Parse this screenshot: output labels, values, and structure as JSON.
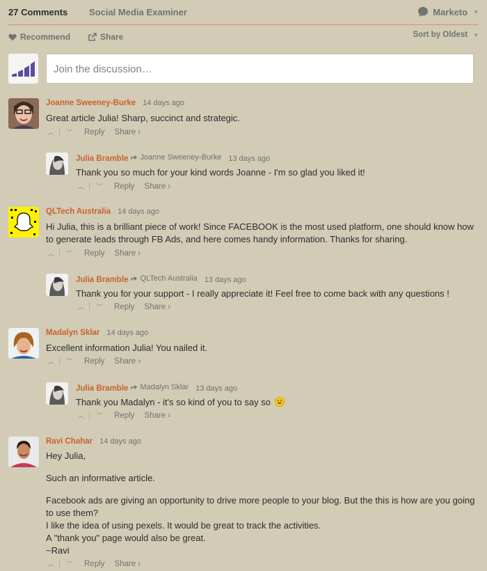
{
  "header": {
    "comments_tab": "27 Comments",
    "site_tab": "Social Media Examiner",
    "user": "Marketo"
  },
  "actions": {
    "recommend": "Recommend",
    "share": "Share",
    "sort": "Sort by Oldest"
  },
  "composer": {
    "placeholder": "Join the discussion…"
  },
  "labels": {
    "reply": "Reply",
    "share": "Share ›"
  },
  "comments": [
    {
      "author": "Joanne Sweeney-Burke",
      "time": "14 days ago",
      "body": [
        "Great article Julia! Sharp, succinct and strategic."
      ],
      "reply": {
        "author": "Julia Bramble",
        "in_reply_to": "Joanne Sweeney-Burke",
        "time": "13 days ago",
        "body": "Thank you so much for your kind words Joanne - I'm so glad you liked it!"
      }
    },
    {
      "author": "QLTech Australia",
      "time": "14 days ago",
      "body": [
        "Hi Julia, this is a brilliant piece of work! Since FACEBOOK is the most used platform, one should know how to generate leads through FB Ads, and here comes handy information. Thanks for sharing."
      ],
      "reply": {
        "author": "Julia Bramble",
        "in_reply_to": "QLTech Australia",
        "time": "13 days ago",
        "body": "Thank you for your support - I really appreciate it! Feel free to come back with any questions !"
      }
    },
    {
      "author": "Madalyn Sklar",
      "time": "14 days ago",
      "body": [
        "Excellent information Julia! You nailed it."
      ],
      "reply": {
        "author": "Julia Bramble",
        "in_reply_to": "Madalyn Sklar",
        "time": "13 days ago",
        "body": "Thank you Madalyn - it's so kind of you to say so"
      }
    },
    {
      "author": "Ravi Chahar",
      "time": "14 days ago",
      "body": [
        "Hey Julia,",
        "Such an informative article.",
        "Facebook ads are giving an opportunity to drive more people to your blog. But the this is how are you going to use them?",
        "I like the idea of using pexels. It would be great to track the activities.",
        "A \"thank you\" page would also be great.",
        "~Ravi"
      ]
    }
  ],
  "colors": {
    "background": "#d2cbb6",
    "author": "#c9622e",
    "accent": "#e0906a"
  }
}
